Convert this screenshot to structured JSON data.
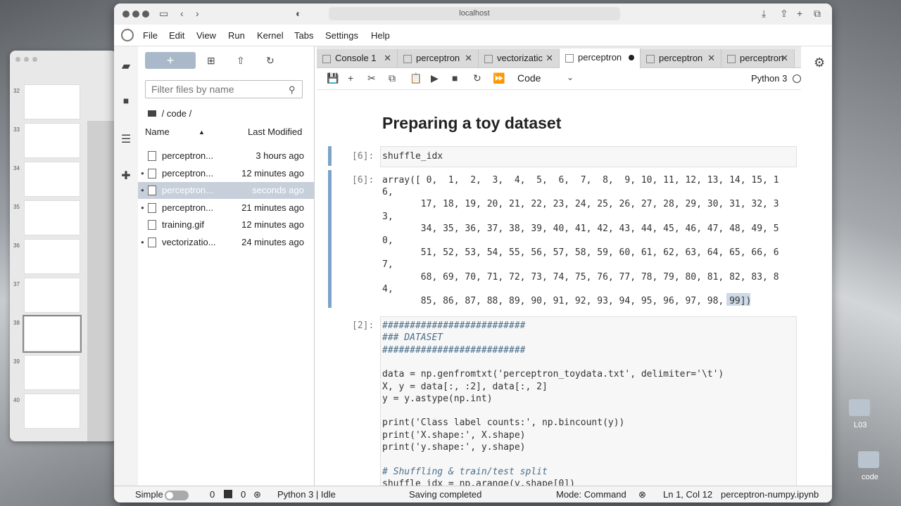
{
  "desktop": {
    "folders": [
      {
        "label": "L03"
      },
      {
        "label": "code"
      }
    ],
    "slide_numbers": [
      "32",
      "33",
      "34",
      "35",
      "36",
      "37",
      "38",
      "39",
      "40"
    ]
  },
  "browser": {
    "url": "localhost"
  },
  "menu": [
    "File",
    "Edit",
    "View",
    "Run",
    "Kernel",
    "Tabs",
    "Settings",
    "Help"
  ],
  "file_browser": {
    "new_label": "+",
    "filter_placeholder": "Filter files by name",
    "breadcrumb": "/ code /",
    "col_name": "Name",
    "col_modified": "Last Modified",
    "files": [
      {
        "name": "perceptron...",
        "modified": "3 hours ago",
        "running": false,
        "selected": false
      },
      {
        "name": "perceptron...",
        "modified": "12 minutes ago",
        "running": true,
        "selected": false
      },
      {
        "name": "perceptron...",
        "modified": "seconds ago",
        "running": true,
        "selected": true
      },
      {
        "name": "perceptron...",
        "modified": "21 minutes ago",
        "running": true,
        "selected": false
      },
      {
        "name": "training.gif",
        "modified": "12 minutes ago",
        "running": false,
        "selected": false
      },
      {
        "name": "vectorizatio...",
        "modified": "24 minutes ago",
        "running": true,
        "selected": false
      }
    ]
  },
  "tabs": [
    {
      "label": "Console 1",
      "active": false,
      "dirty": false
    },
    {
      "label": "perceptron",
      "active": false,
      "dirty": false
    },
    {
      "label": "vectorizatic",
      "active": false,
      "dirty": false
    },
    {
      "label": "perceptron",
      "active": true,
      "dirty": true
    },
    {
      "label": "perceptron",
      "active": false,
      "dirty": false
    },
    {
      "label": "perceptron",
      "active": false,
      "dirty": false
    }
  ],
  "toolbar": {
    "cell_type": "Code",
    "kernel": "Python 3"
  },
  "notebook": {
    "heading": "Preparing a toy dataset",
    "cell1": {
      "prompt": "[6]:",
      "code": "shuffle_idx"
    },
    "output1": {
      "prompt": "[6]:",
      "lines": [
        "array([ 0,  1,  2,  3,  4,  5,  6,  7,  8,  9, 10, 11, 12, 13, 14, 15, 1",
        "6,",
        "       17, 18, 19, 20, 21, 22, 23, 24, 25, 26, 27, 28, 29, 30, 31, 32, 3",
        "3,",
        "       34, 35, 36, 37, 38, 39, 40, 41, 42, 43, 44, 45, 46, 47, 48, 49, 5",
        "0,",
        "       51, 52, 53, 54, 55, 56, 57, 58, 59, 60, 61, 62, 63, 64, 65, 66, 6",
        "7,",
        "       68, 69, 70, 71, 72, 73, 74, 75, 76, 77, 78, 79, 80, 81, 82, 83, 8",
        "4,",
        "       85, 86, 87, 88, 89, 90, 91, 92, 93, 94, 95, 96, 97, 98, 99])"
      ]
    },
    "cell2": {
      "prompt": "[2]:",
      "lines": [
        "##########################",
        "### DATASET",
        "##########################",
        "",
        "data = np.genfromtxt('perceptron_toydata.txt', delimiter='\\t')",
        "X, y = data[:, :2], data[:, 2]",
        "y = y.astype(np.int)",
        "",
        "print('Class label counts:', np.bincount(y))",
        "print('X.shape:', X.shape)",
        "print('y.shape:', y.shape)",
        "",
        "# Shuffling & train/test split",
        "shuffle_idx = np.arange(y.shape[0])"
      ]
    }
  },
  "status": {
    "mode_label": "Simple",
    "terminals": "0",
    "kernels": "0",
    "kernel_status": "Python 3 | Idle",
    "save_status": "Saving completed",
    "mode": "Mode: Command",
    "cursor": "Ln 1, Col 12",
    "filename": "perceptron-numpy.ipynb"
  }
}
